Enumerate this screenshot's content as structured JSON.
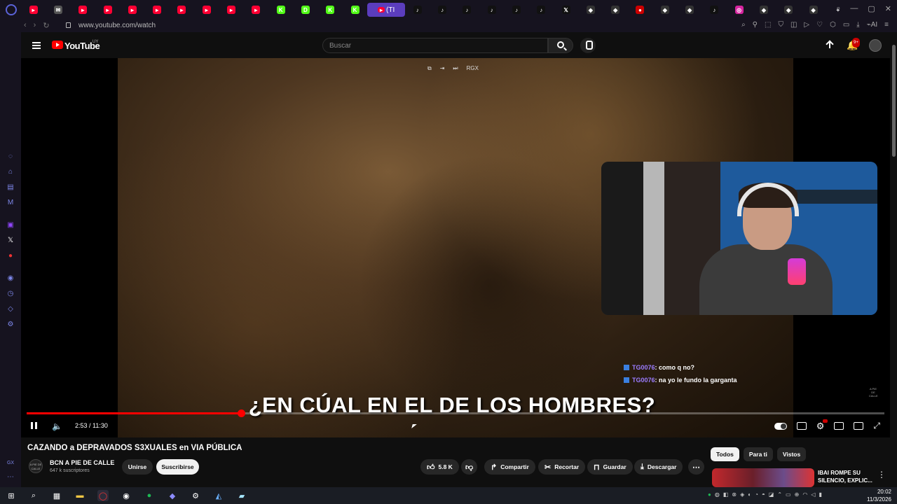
{
  "browser": {
    "url": "www.youtube.com/watch",
    "active_tab_label": "(TI",
    "tab_icons": [
      "yt",
      "mail",
      "yt",
      "yt",
      "yt",
      "yt",
      "yt",
      "yt",
      "yt",
      "yt",
      "kick",
      "d-app",
      "kick-mute",
      "kick",
      "yt-active",
      "tiktok",
      "tiktok",
      "tiktok",
      "tiktok",
      "tiktok",
      "tiktok",
      "x",
      "app",
      "app",
      "record",
      "app",
      "app",
      "tiktok",
      "instagram",
      "app",
      "app",
      "app",
      "plus"
    ]
  },
  "youtube": {
    "logo_text": "YouTube",
    "country_code": "UY",
    "search_placeholder": "Buscar",
    "notification_count": "9+"
  },
  "player": {
    "pip_tools": [
      "⧉",
      "⇥",
      "⏭",
      "RGX"
    ],
    "caption": "¿EN CÚAL EN EL DE LOS HOMBRES?",
    "time": "2:53 / 11:30",
    "progress_fraction": 0.25,
    "watermark": "A PIE DE CALLE",
    "chat": [
      {
        "user": "TG0076",
        "message": ": como q no?"
      },
      {
        "user": "TG0076",
        "message": ": na yo le fundo la garganta"
      }
    ]
  },
  "video": {
    "title": "CAZANDO a DEPRAVADOS S3XUALES en VIA PÚBLICA",
    "channel_name": "BCN A PIE DE CALLE",
    "channel_avatar_text": "A PIE DE CALLE",
    "subscribers": "647 k suscriptores",
    "join_label": "Unirse",
    "subscribe_label": "Suscribirse",
    "likes": "5.8 K",
    "share_label": "Compartir",
    "clip_label": "Recortar",
    "save_label": "Guardar",
    "download_label": "Descargar"
  },
  "chips": [
    "Todos",
    "Para ti",
    "Vistos"
  ],
  "recommendation": {
    "title_line1": "IBAI ROMPE SU",
    "title_line2": "SILENCIO, EXPLIC..."
  },
  "taskbar": {
    "time": "20:02",
    "date": "11/3/2026"
  },
  "colors": {
    "accent_red": "#ff0000",
    "opera_purple": "#5b3dbd",
    "chat_user": "#9b7cff"
  }
}
